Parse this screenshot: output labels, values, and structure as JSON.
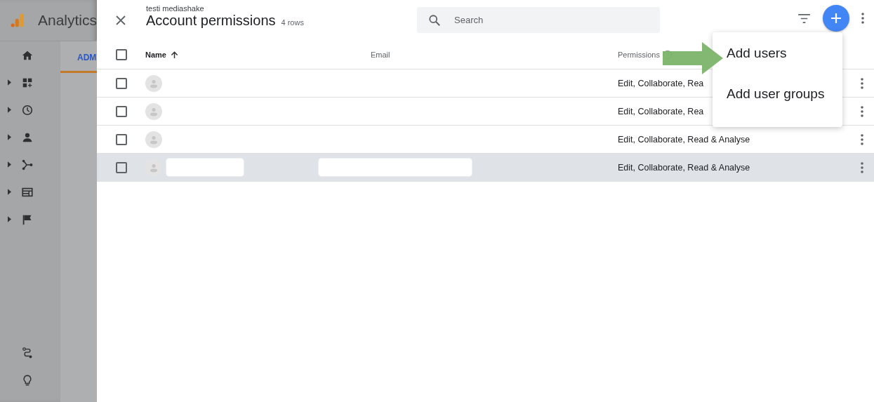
{
  "app": {
    "title": "Analytics",
    "tab": "ADM"
  },
  "sidebar": {
    "items": [
      {
        "expandable": false
      },
      {
        "expandable": true
      },
      {
        "expandable": true
      },
      {
        "expandable": true
      },
      {
        "expandable": true
      },
      {
        "expandable": true
      },
      {
        "expandable": true
      }
    ]
  },
  "panel": {
    "subtitle": "testi mediashake",
    "title": "Account permissions",
    "count": "4 rows",
    "search": {
      "placeholder": "Search"
    },
    "table": {
      "all_checked": false,
      "columns": [
        {
          "label": "Name",
          "sorted": true
        },
        {
          "label": "Email",
          "sorted": false
        },
        {
          "label": "Permissions",
          "sorted": false
        }
      ],
      "rows": [
        {
          "checked": false,
          "highlighted": false,
          "redacted": false,
          "permissions": "Edit, Collaborate, Rea"
        },
        {
          "checked": false,
          "highlighted": false,
          "redacted": false,
          "permissions": "Edit, Collaborate, Rea"
        },
        {
          "checked": false,
          "highlighted": false,
          "redacted": false,
          "permissions": "Edit, Collaborate, Read & Analyse"
        },
        {
          "checked": false,
          "highlighted": true,
          "redacted": true,
          "permissions": "Edit, Collaborate, Read & Analyse"
        }
      ]
    },
    "menu": {
      "items": [
        "Add users",
        "Add user groups"
      ]
    }
  }
}
